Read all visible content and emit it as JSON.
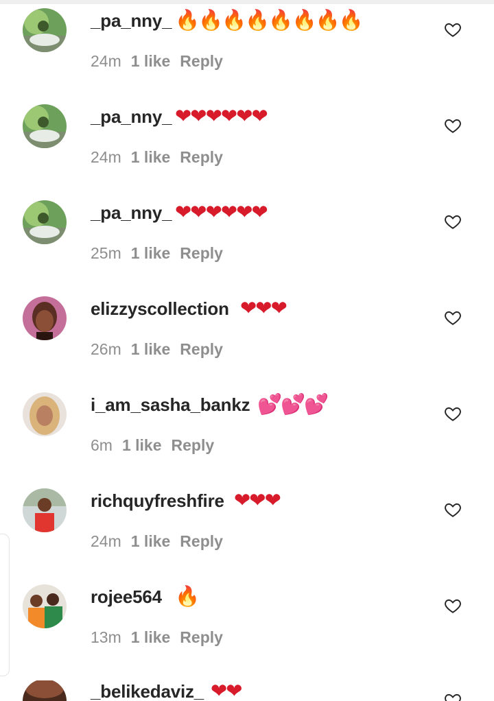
{
  "comments": [
    {
      "username": "_pa_nny_",
      "emoji": "🔥🔥🔥🔥🔥🔥🔥🔥",
      "emoji_color": "#f28b1a",
      "time": "24m",
      "likes": "1 like",
      "reply": "Reply",
      "avatar": "pa"
    },
    {
      "username": "_pa_nny_",
      "emoji": "❤❤❤❤❤❤",
      "emoji_color": "#d81b2b",
      "time": "24m",
      "likes": "1 like",
      "reply": "Reply",
      "avatar": "pa"
    },
    {
      "username": "_pa_nny_",
      "emoji": "❤❤❤❤❤❤",
      "emoji_color": "#d81b2b",
      "time": "25m",
      "likes": "1 like",
      "reply": "Reply",
      "avatar": "pa"
    },
    {
      "username": "elizzyscollection",
      "emoji": "❤❤❤",
      "emoji_color": "#d81b2b",
      "time": "26m",
      "likes": "1 like",
      "reply": "Reply",
      "avatar": "el"
    },
    {
      "username": "i_am_sasha_bankz",
      "emoji": "💕💕💕",
      "emoji_color": "#ee3f8f",
      "time": "6m",
      "likes": "1 like",
      "reply": "Reply",
      "avatar": "sa"
    },
    {
      "username": "richquyfreshfire",
      "emoji": "❤❤❤",
      "emoji_color": "#d81b2b",
      "time": "24m",
      "likes": "1 like",
      "reply": "Reply",
      "avatar": "ri"
    },
    {
      "username": "rojee564",
      "emoji": "🔥",
      "emoji_color": "#f28b1a",
      "time": "13m",
      "likes": "1 like",
      "reply": "Reply",
      "avatar": "ro"
    },
    {
      "username": "_belikedaviz_",
      "emoji": "❤❤",
      "emoji_color": "#d81b2b",
      "time": "",
      "likes": "",
      "reply": "",
      "avatar": "be"
    }
  ]
}
